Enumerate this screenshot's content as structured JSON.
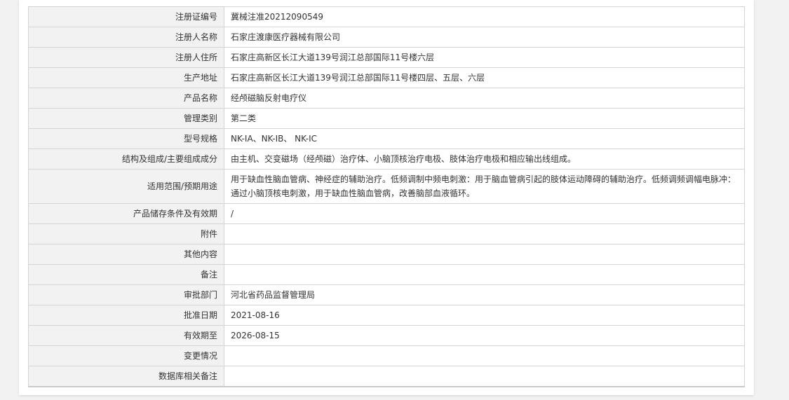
{
  "rows": [
    {
      "label": "注册证编号",
      "value": "冀械注准20212090549"
    },
    {
      "label": "注册人名称",
      "value": "石家庄渡康医疗器械有限公司"
    },
    {
      "label": "注册人住所",
      "value": "石家庄高新区长江大道139号润江总部国际11号楼六层"
    },
    {
      "label": "生产地址",
      "value": "石家庄高新区长江大道139号润江总部国际11号楼四层、五层、六层"
    },
    {
      "label": "产品名称",
      "value": "经颅磁脑反射电疗仪"
    },
    {
      "label": "管理类别",
      "value": "第二类"
    },
    {
      "label": "型号规格",
      "value": "NK-IA、NK-IB、 NK-IC"
    },
    {
      "label": "结构及组成/主要组成成分",
      "value": "由主机、交变磁场（经颅磁）治疗体、小脑顶核治疗电极、肢体治疗电极和相应输出线组成。"
    },
    {
      "label": "适用范围/预期用途",
      "value": "用于缺血性脑血管病、神经症的辅助治疗。低频调制中频电刺激：用于脑血管病引起的肢体运动障碍的辅助治疗。低频调频调幅电脉冲：通过小脑顶核电刺激，用于缺血性脑血管病，改善脑部血液循环。"
    },
    {
      "label": "产品储存条件及有效期",
      "value": "/"
    },
    {
      "label": "附件",
      "value": ""
    },
    {
      "label": "其他内容",
      "value": ""
    },
    {
      "label": "备注",
      "value": ""
    },
    {
      "label": "审批部门",
      "value": "河北省药品监督管理局"
    },
    {
      "label": "批准日期",
      "value": "2021-08-16"
    },
    {
      "label": "有效期至",
      "value": "2026-08-15"
    },
    {
      "label": "变更情况",
      "value": ""
    },
    {
      "label": "数据库相关备注",
      "value": ""
    }
  ],
  "colors": {
    "label_bg": "#f2f2f2",
    "border": "#d4d4d4",
    "text": "#333333",
    "page_bg": "#f2f2f2"
  }
}
